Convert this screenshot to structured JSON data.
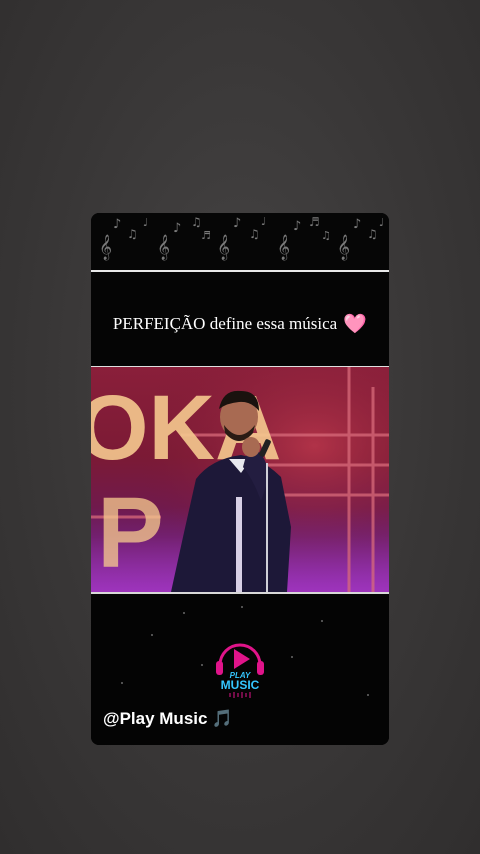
{
  "story": {
    "caption": "PERFEIÇÃO define essa música",
    "caption_emoji": "🩷",
    "handle": "@Play Music",
    "handle_emoji": "🎵",
    "logo": {
      "line1": "PLAY",
      "line2": "MUSIC",
      "icon": "headphones-play-icon"
    },
    "video_background_text": [
      "OKA",
      "P"
    ]
  },
  "colors": {
    "backdrop": "#3a3838",
    "card": "#050505",
    "caption_text": "#ffffff",
    "heart": "#ff7fc0",
    "logo_magenta": "#e0148a",
    "logo_cyan": "#35c6ff",
    "stage_red": "#8a1f3a",
    "stage_purple": "#8a2aa0"
  }
}
